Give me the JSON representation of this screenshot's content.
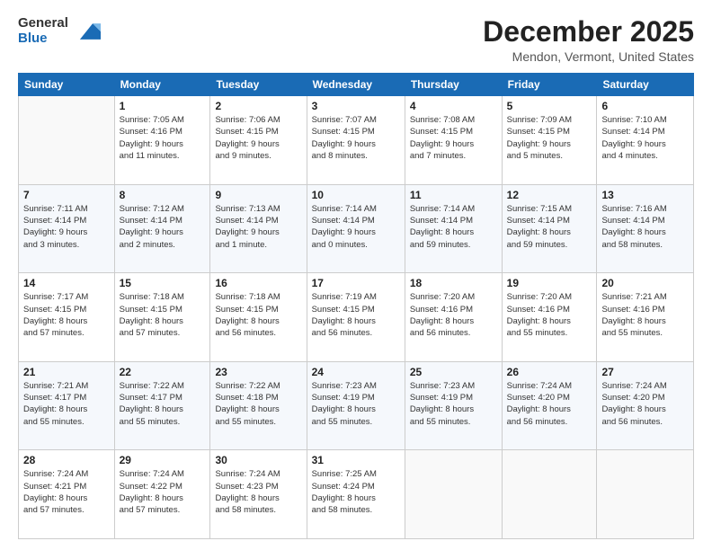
{
  "logo": {
    "general": "General",
    "blue": "Blue"
  },
  "title": "December 2025",
  "subtitle": "Mendon, Vermont, United States",
  "calendar": {
    "headers": [
      "Sunday",
      "Monday",
      "Tuesday",
      "Wednesday",
      "Thursday",
      "Friday",
      "Saturday"
    ],
    "weeks": [
      [
        {
          "day": "",
          "text": ""
        },
        {
          "day": "1",
          "text": "Sunrise: 7:05 AM\nSunset: 4:16 PM\nDaylight: 9 hours\nand 11 minutes."
        },
        {
          "day": "2",
          "text": "Sunrise: 7:06 AM\nSunset: 4:15 PM\nDaylight: 9 hours\nand 9 minutes."
        },
        {
          "day": "3",
          "text": "Sunrise: 7:07 AM\nSunset: 4:15 PM\nDaylight: 9 hours\nand 8 minutes."
        },
        {
          "day": "4",
          "text": "Sunrise: 7:08 AM\nSunset: 4:15 PM\nDaylight: 9 hours\nand 7 minutes."
        },
        {
          "day": "5",
          "text": "Sunrise: 7:09 AM\nSunset: 4:15 PM\nDaylight: 9 hours\nand 5 minutes."
        },
        {
          "day": "6",
          "text": "Sunrise: 7:10 AM\nSunset: 4:14 PM\nDaylight: 9 hours\nand 4 minutes."
        }
      ],
      [
        {
          "day": "7",
          "text": "Sunrise: 7:11 AM\nSunset: 4:14 PM\nDaylight: 9 hours\nand 3 minutes."
        },
        {
          "day": "8",
          "text": "Sunrise: 7:12 AM\nSunset: 4:14 PM\nDaylight: 9 hours\nand 2 minutes."
        },
        {
          "day": "9",
          "text": "Sunrise: 7:13 AM\nSunset: 4:14 PM\nDaylight: 9 hours\nand 1 minute."
        },
        {
          "day": "10",
          "text": "Sunrise: 7:14 AM\nSunset: 4:14 PM\nDaylight: 9 hours\nand 0 minutes."
        },
        {
          "day": "11",
          "text": "Sunrise: 7:14 AM\nSunset: 4:14 PM\nDaylight: 8 hours\nand 59 minutes."
        },
        {
          "day": "12",
          "text": "Sunrise: 7:15 AM\nSunset: 4:14 PM\nDaylight: 8 hours\nand 59 minutes."
        },
        {
          "day": "13",
          "text": "Sunrise: 7:16 AM\nSunset: 4:14 PM\nDaylight: 8 hours\nand 58 minutes."
        }
      ],
      [
        {
          "day": "14",
          "text": "Sunrise: 7:17 AM\nSunset: 4:15 PM\nDaylight: 8 hours\nand 57 minutes."
        },
        {
          "day": "15",
          "text": "Sunrise: 7:18 AM\nSunset: 4:15 PM\nDaylight: 8 hours\nand 57 minutes."
        },
        {
          "day": "16",
          "text": "Sunrise: 7:18 AM\nSunset: 4:15 PM\nDaylight: 8 hours\nand 56 minutes."
        },
        {
          "day": "17",
          "text": "Sunrise: 7:19 AM\nSunset: 4:15 PM\nDaylight: 8 hours\nand 56 minutes."
        },
        {
          "day": "18",
          "text": "Sunrise: 7:20 AM\nSunset: 4:16 PM\nDaylight: 8 hours\nand 56 minutes."
        },
        {
          "day": "19",
          "text": "Sunrise: 7:20 AM\nSunset: 4:16 PM\nDaylight: 8 hours\nand 55 minutes."
        },
        {
          "day": "20",
          "text": "Sunrise: 7:21 AM\nSunset: 4:16 PM\nDaylight: 8 hours\nand 55 minutes."
        }
      ],
      [
        {
          "day": "21",
          "text": "Sunrise: 7:21 AM\nSunset: 4:17 PM\nDaylight: 8 hours\nand 55 minutes."
        },
        {
          "day": "22",
          "text": "Sunrise: 7:22 AM\nSunset: 4:17 PM\nDaylight: 8 hours\nand 55 minutes."
        },
        {
          "day": "23",
          "text": "Sunrise: 7:22 AM\nSunset: 4:18 PM\nDaylight: 8 hours\nand 55 minutes."
        },
        {
          "day": "24",
          "text": "Sunrise: 7:23 AM\nSunset: 4:19 PM\nDaylight: 8 hours\nand 55 minutes."
        },
        {
          "day": "25",
          "text": "Sunrise: 7:23 AM\nSunset: 4:19 PM\nDaylight: 8 hours\nand 55 minutes."
        },
        {
          "day": "26",
          "text": "Sunrise: 7:24 AM\nSunset: 4:20 PM\nDaylight: 8 hours\nand 56 minutes."
        },
        {
          "day": "27",
          "text": "Sunrise: 7:24 AM\nSunset: 4:20 PM\nDaylight: 8 hours\nand 56 minutes."
        }
      ],
      [
        {
          "day": "28",
          "text": "Sunrise: 7:24 AM\nSunset: 4:21 PM\nDaylight: 8 hours\nand 57 minutes."
        },
        {
          "day": "29",
          "text": "Sunrise: 7:24 AM\nSunset: 4:22 PM\nDaylight: 8 hours\nand 57 minutes."
        },
        {
          "day": "30",
          "text": "Sunrise: 7:24 AM\nSunset: 4:23 PM\nDaylight: 8 hours\nand 58 minutes."
        },
        {
          "day": "31",
          "text": "Sunrise: 7:25 AM\nSunset: 4:24 PM\nDaylight: 8 hours\nand 58 minutes."
        },
        {
          "day": "",
          "text": ""
        },
        {
          "day": "",
          "text": ""
        },
        {
          "day": "",
          "text": ""
        }
      ]
    ]
  }
}
